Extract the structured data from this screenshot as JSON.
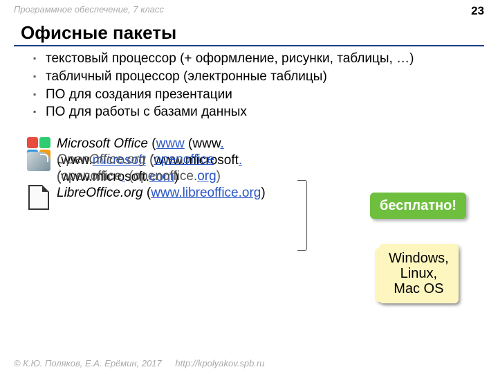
{
  "header": {
    "course": "Программное обеспечение, 7 класс",
    "page": "23"
  },
  "title": "Офисные пакеты",
  "bullets": [
    "текстовый процессор (+ оформление, рисунки, таблицы, …)",
    "табличный процессор (электронные таблицы)",
    "ПО для создания презентации",
    "ПО для работы с базами данных"
  ],
  "products": {
    "ms": {
      "name": "Microsoft Office",
      "l1a": "www",
      "l1b": " (www",
      "l1c": ".",
      "l2a": "(www.",
      "l2b": "microsoft",
      "l2c": " (www.microsoft",
      "l2d": ".",
      "l3a": "(www.microsoft.",
      "l3b": "com",
      "l3c": ")"
    },
    "oo": {
      "name": "OpenOffice.org",
      "l1a": "openoffice",
      "l2a": "(openoffice",
      "l2b": ".",
      "l2c": " (openoffice.",
      "l2d": "org",
      "l2e": ")"
    },
    "libre": {
      "name": "LibreOffice.org",
      "open": " (",
      "url": "www.libreoffice.org",
      "close": ")"
    }
  },
  "callouts": {
    "free": "бесплатно!",
    "os_l1": "Windows,",
    "os_l2": "Linux,",
    "os_l3": "Mac OS"
  },
  "footer": {
    "copyright": "© К.Ю. Поляков, Е.А. Ерёмин, 2017",
    "url": "http://kpolyakov.spb.ru"
  }
}
